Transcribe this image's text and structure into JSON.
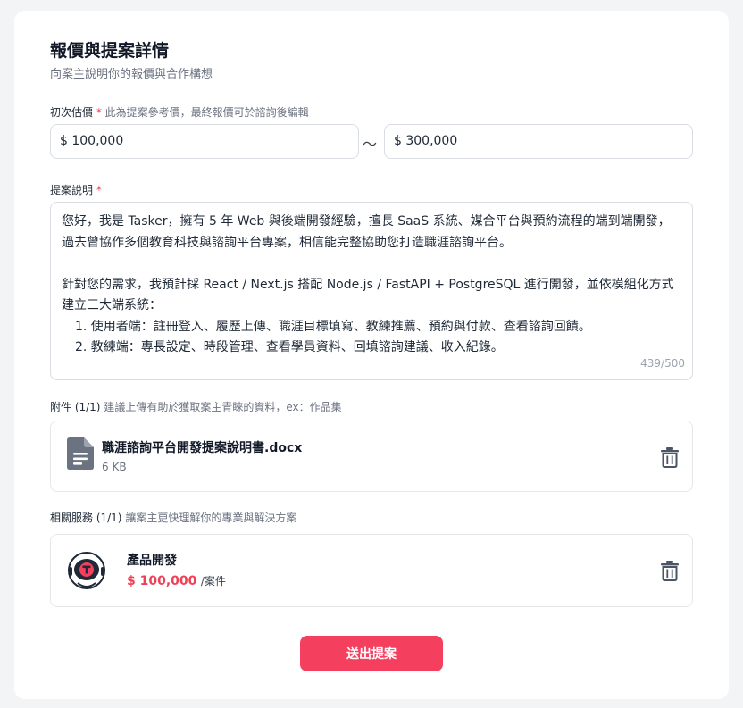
{
  "header": {
    "title": "報價與提案詳情",
    "subtitle": "向案主說明你的報價與合作構想"
  },
  "estimate": {
    "label": "初次估價",
    "required_mark": "*",
    "hint": "此為提案參考價，最終報價可於諮詢後編輯",
    "min_value": "$ 100,000",
    "separator": "～",
    "max_value": "$ 300,000"
  },
  "proposal": {
    "label": "提案說明",
    "required_mark": "*",
    "paragraph1": "您好，我是 Tasker，擁有 5 年 Web 與後端開發經驗，擅長 SaaS 系統、媒合平台與預約流程的端到端開發，過去曾協作多個教育科技與諮詢平台專案，相信能完整協助您打造職涯諮詢平台。",
    "paragraph2": "針對您的需求，我預計採 React / Next.js 搭配 Node.js / FastAPI + PostgreSQL 進行開發，並依模組化方式建立三大端系統：",
    "list": [
      "1.  使用者端：註冊登入、履歷上傳、職涯目標填寫、教練推薦、預約與付款、查看諮詢回饋。",
      "2. 教練端：專長設定、時段管理、查看學員資料、回填諮詢建議、收入紀錄。"
    ],
    "counter": "439/500"
  },
  "attachments": {
    "label": "附件 (1/1)",
    "hint": "建議上傳有助於獲取案主青睞的資料，ex：作品集",
    "file": {
      "name": "職涯諮詢平台開發提案說明書.docx",
      "size": "6 KB",
      "icon": "document-icon"
    }
  },
  "services": {
    "label": "相關服務 (1/1)",
    "hint": "讓案主更快理解你的專業與解決方案",
    "item": {
      "name": "產品開發",
      "price": "$ 100,000",
      "unit": "/案件"
    }
  },
  "submit_label": "送出提案",
  "colors": {
    "accent": "#f43f5e",
    "required": "#ef4058",
    "icon": "#6b7280"
  }
}
